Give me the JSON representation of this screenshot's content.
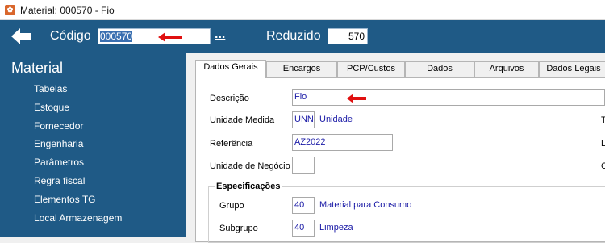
{
  "window": {
    "title": "Material: 000570 - Fio"
  },
  "header": {
    "codigo_label": "Código",
    "codigo_value": "000570",
    "ellipsis": "...",
    "reduzido_label": "Reduzido",
    "reduzido_value": "570",
    "bg_color": "#1f5a86"
  },
  "sidebar": {
    "title": "Material",
    "items": [
      {
        "label": "Tabelas"
      },
      {
        "label": "Estoque"
      },
      {
        "label": "Fornecedor"
      },
      {
        "label": "Engenharia"
      },
      {
        "label": "Parâmetros"
      },
      {
        "label": "Regra fiscal"
      },
      {
        "label": "Elementos TG"
      },
      {
        "label": "Local Armazenagem"
      }
    ]
  },
  "tabs": [
    {
      "label": "Dados Gerais",
      "active": true
    },
    {
      "label": "Encargos"
    },
    {
      "label": "PCP/Custos"
    },
    {
      "label": "Dados Adicionais"
    },
    {
      "label": "Arquivos"
    },
    {
      "label": "Dados Legais"
    }
  ],
  "form": {
    "descricao": {
      "label": "Descrição",
      "value": "Fio"
    },
    "unidade_medida": {
      "label": "Unidade Medida",
      "value": "UNN",
      "description": "Unidade"
    },
    "referencia": {
      "label": "Referência",
      "value": "AZ2022"
    },
    "unidade_negocio": {
      "label": "Unidade de Negócio",
      "value": ""
    },
    "especificacoes": {
      "title": "Especificações",
      "grupo": {
        "label": "Grupo",
        "value": "40",
        "description": "Material para Consumo"
      },
      "subgrupo": {
        "label": "Subgrupo",
        "value": "40",
        "description": "Limpeza"
      }
    },
    "edge_letters": [
      "T",
      "L",
      "C"
    ]
  },
  "icons": {
    "app": "app-logo-icon",
    "back": "back-arrow-icon",
    "annotation": "red-arrow-icon"
  },
  "colors": {
    "accent_red": "#e01010",
    "link_blue": "#1a1aa6"
  }
}
